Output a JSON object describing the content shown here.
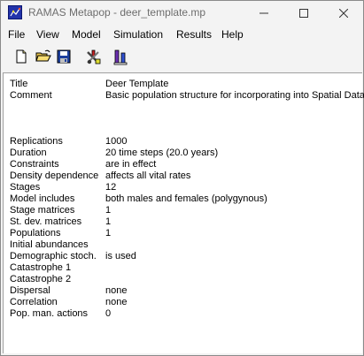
{
  "window": {
    "title": "RAMAS Metapop - deer_template.mp"
  },
  "menu": {
    "items": [
      "File",
      "View",
      "Model",
      "Simulation",
      "Results",
      "Help"
    ]
  },
  "toolbar": {
    "buttons": [
      {
        "icon": "new-file-icon"
      },
      {
        "icon": "open-folder-icon"
      },
      {
        "icon": "save-disk-icon"
      },
      {
        "icon": "model-tools-icon"
      },
      {
        "icon": "run-simulation-icon"
      }
    ]
  },
  "summary": {
    "header": [
      {
        "label": "Title",
        "value": "Deer Template"
      },
      {
        "label": "Comment",
        "value": "Basic population structure for incorporating into Spatial Data"
      }
    ],
    "rows": [
      {
        "label": "Replications",
        "value": "1000"
      },
      {
        "label": "Duration",
        "value": "20 time steps (20.0 years)"
      },
      {
        "label": "Constraints",
        "value": "are in effect"
      },
      {
        "label": "Density dependence",
        "value": "affects all vital rates"
      },
      {
        "label": "Stages",
        "value": "12"
      },
      {
        "label": "Model includes",
        "value": "both males and females (polygynous)"
      },
      {
        "label": "Stage matrices",
        "value": "1"
      },
      {
        "label": "St. dev. matrices",
        "value": "1"
      },
      {
        "label": "Populations",
        "value": "1"
      },
      {
        "label": "Initial abundances",
        "value": ""
      },
      {
        "label": "Demographic stoch.",
        "value": "is used"
      },
      {
        "label": "Catastrophe 1",
        "value": ""
      },
      {
        "label": "Catastrophe 2",
        "value": ""
      },
      {
        "label": "Dispersal",
        "value": "none"
      },
      {
        "label": "Correlation",
        "value": "none"
      },
      {
        "label": "Pop. man. actions",
        "value": "0"
      }
    ]
  }
}
